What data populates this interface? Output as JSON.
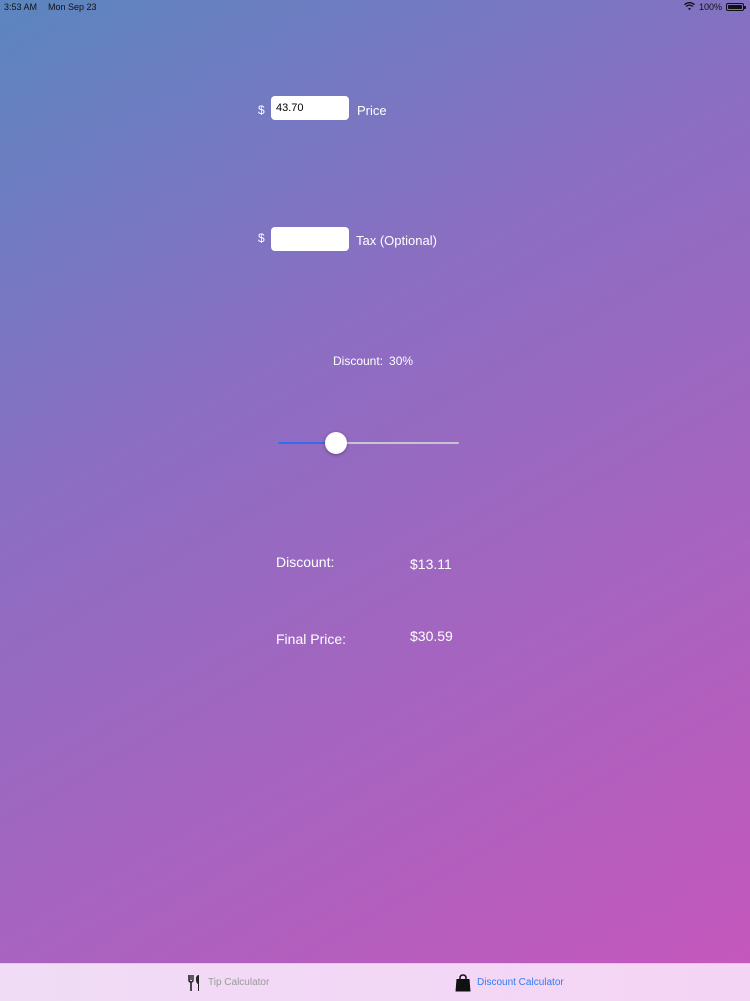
{
  "status_bar": {
    "time": "3:53 AM",
    "date": "Mon Sep 23",
    "battery_text": "100%",
    "icons": [
      "wifi-icon",
      "battery-icon"
    ]
  },
  "price": {
    "currency": "$",
    "value": "43.70",
    "label": "Price"
  },
  "tax": {
    "currency": "$",
    "value": "",
    "label": "Tax (Optional)"
  },
  "discount": {
    "label": "Discount:",
    "percent_text": "30%",
    "slider_fraction": 0.32
  },
  "results": {
    "discount_label": "Discount:",
    "discount_value": "$13.11",
    "final_label": "Final Price:",
    "final_value": "$30.59"
  },
  "tab_bar": {
    "tabs": [
      {
        "label": "Tip Calculator",
        "icon": "fork-knife-icon",
        "selected": false
      },
      {
        "label": "Discount Calculator",
        "icon": "shopping-bag-icon",
        "selected": true
      }
    ]
  },
  "colors": {
    "accent": "#2f7cf6",
    "slider_fill": "#2f6cf0",
    "inactive_tab": "#9a9a9a"
  }
}
